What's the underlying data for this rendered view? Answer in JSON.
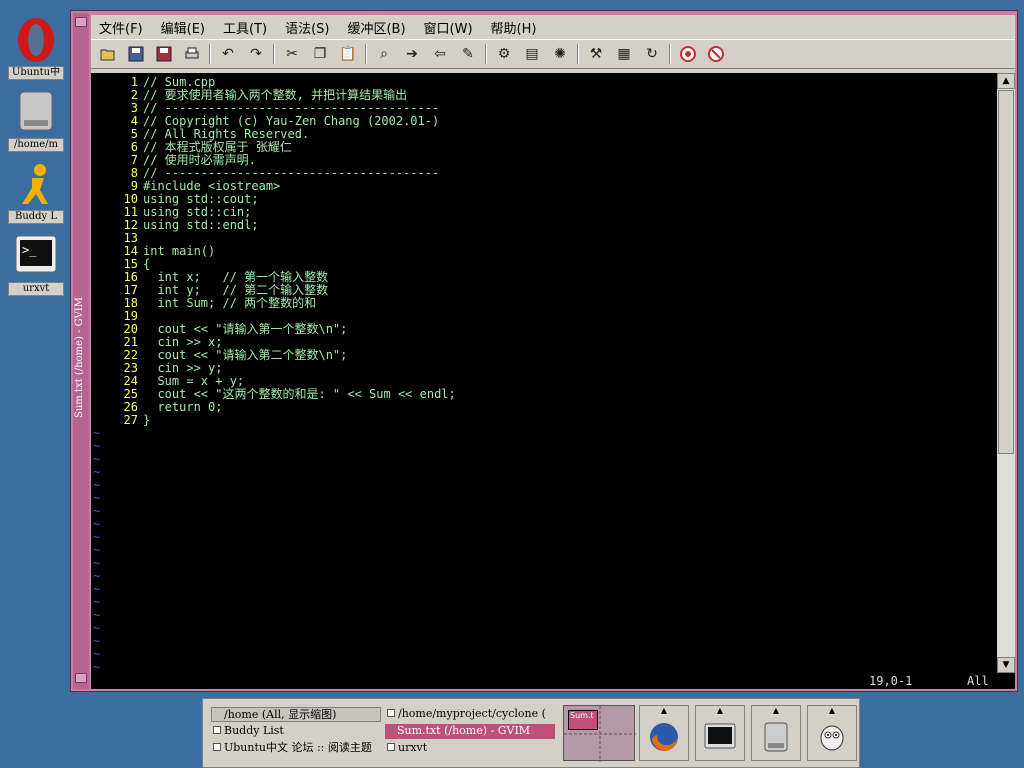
{
  "desktop": {
    "icons": [
      {
        "label": "Ubuntu中",
        "icon": "opera-icon"
      },
      {
        "label": "/home/m",
        "icon": "drive-icon"
      },
      {
        "label": "Buddy L",
        "icon": "aim-icon"
      },
      {
        "label": "urxvt",
        "icon": "terminal-icon"
      }
    ]
  },
  "window": {
    "title": "Sum.txt (/home) - GVIM",
    "menu": [
      "文件(F)",
      "编辑(E)",
      "工具(T)",
      "语法(S)",
      "缓冲区(B)",
      "窗口(W)",
      "帮助(H)"
    ],
    "toolbar": [
      "open-icon",
      "save-icon",
      "save-all-icon",
      "print-icon",
      "undo-icon",
      "redo-icon",
      "cut-icon",
      "copy-icon",
      "paste-icon",
      "find-icon",
      "find-next-icon",
      "find-prev-icon",
      "load-session-icon",
      "save-session-icon",
      "run-script-icon",
      "make-icon",
      "run-ctags-icon",
      "jump-tag-icon",
      "help-icon",
      "find-help-icon"
    ]
  },
  "editor": {
    "lines": [
      {
        "n": "1",
        "t": "// Sum.cpp"
      },
      {
        "n": "2",
        "t": "// 要求使用者输入两个整数, 并把计算结果输出"
      },
      {
        "n": "3",
        "t": "// --------------------------------------"
      },
      {
        "n": "4",
        "t": "// Copyright (c) Yau-Zen Chang (2002.01-)"
      },
      {
        "n": "5",
        "t": "// All Rights Reserved."
      },
      {
        "n": "6",
        "t": "// 本程式版权属于 张耀仁"
      },
      {
        "n": "7",
        "t": "// 使用时必需声明."
      },
      {
        "n": "8",
        "t": "// --------------------------------------"
      },
      {
        "n": "9",
        "t": "#include <iostream>"
      },
      {
        "n": "10",
        "t": "using std::cout;"
      },
      {
        "n": "11",
        "t": "using std::cin;"
      },
      {
        "n": "12",
        "t": "using std::endl;"
      },
      {
        "n": "13",
        "t": ""
      },
      {
        "n": "14",
        "t": "int main()"
      },
      {
        "n": "15",
        "t": "{"
      },
      {
        "n": "16",
        "t": "  int x;   // 第一个输入整数"
      },
      {
        "n": "17",
        "t": "  int y;   // 第二个输入整数"
      },
      {
        "n": "18",
        "t": "  int Sum; // 两个整数的和"
      },
      {
        "n": "19",
        "t": ""
      },
      {
        "n": "20",
        "t": "  cout << \"请输入第一个整数\\n\";"
      },
      {
        "n": "21",
        "t": "  cin >> x;"
      },
      {
        "n": "22",
        "t": "  cout << \"请输入第二个整数\\n\";"
      },
      {
        "n": "23",
        "t": "  cin >> y;"
      },
      {
        "n": "24",
        "t": "  Sum = x + y;"
      },
      {
        "n": "25",
        "t": "  cout << \"这两个整数的和是: \" << Sum << endl;"
      },
      {
        "n": "26",
        "t": "  return 0;"
      },
      {
        "n": "27",
        "t": "}"
      }
    ],
    "tilde_count": 19,
    "tilde_char": "~",
    "status_pos": "19,0-1",
    "status_all": "All"
  },
  "taskbar": {
    "tasks_col1": [
      "/home (All, 显示缩图)",
      "Buddy List",
      "Ubuntu中文 论坛 :: 阅读主题"
    ],
    "tasks_col2": [
      "/home/myproject/cyclone (",
      "Sum.txt (/home) - GVIM",
      "urxvt"
    ],
    "pager_label": "Sum.t",
    "launchers": [
      "firefox-icon",
      "terminal-icon",
      "drive-icon",
      "gimp-icon"
    ]
  }
}
